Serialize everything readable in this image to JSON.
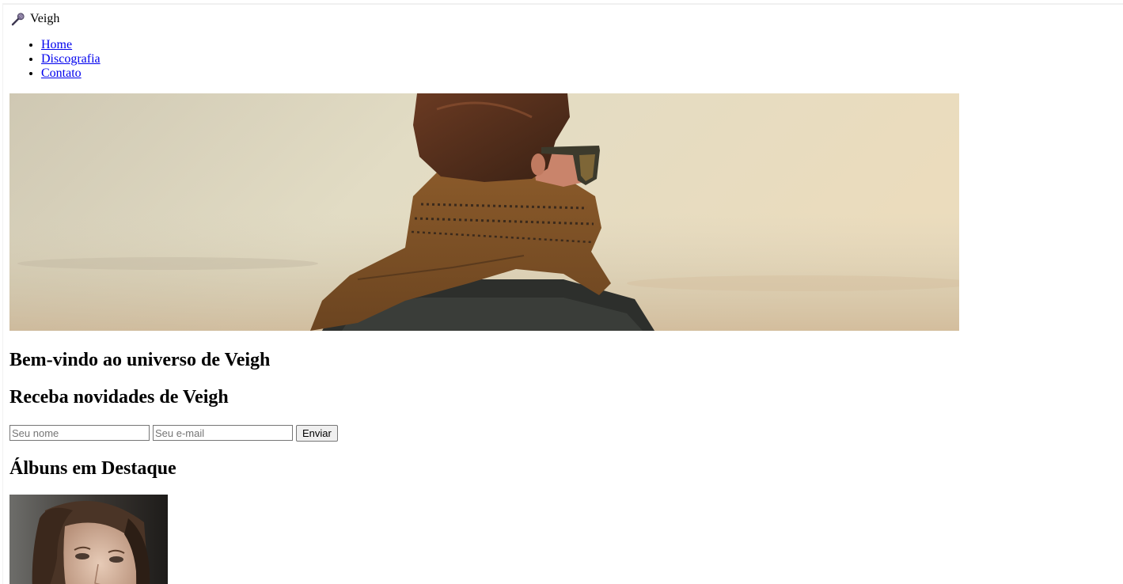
{
  "brand": {
    "name": "Veigh",
    "icon": "microphone-icon"
  },
  "nav": {
    "items": [
      {
        "label": "Home"
      },
      {
        "label": "Discografia"
      },
      {
        "label": "Contato"
      }
    ]
  },
  "hero": {
    "image": "person-with-scarf-photo"
  },
  "welcome": {
    "title": "Bem-vindo ao universo de Veigh"
  },
  "newsletter": {
    "title": "Receba novidades de Veigh",
    "name_placeholder": "Seu nome",
    "name_value": "",
    "email_placeholder": "Seu e-mail",
    "email_value": "",
    "submit_label": "Enviar"
  },
  "albums": {
    "title": "Álbuns em Destaque",
    "items": [
      {
        "image": "album-cover-woman-portrait"
      }
    ]
  },
  "colors": {
    "link": "#0000ee",
    "text": "#000000",
    "background": "#ffffff"
  }
}
